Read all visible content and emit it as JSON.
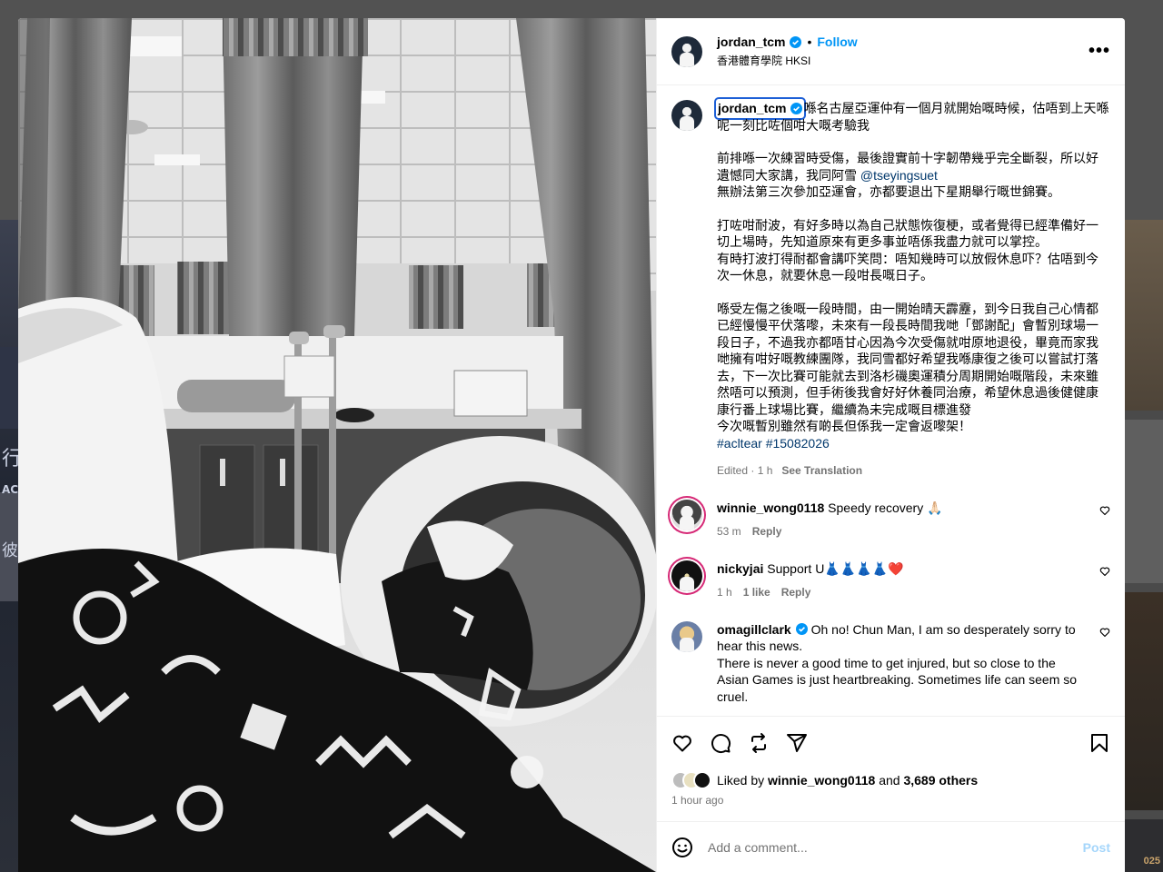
{
  "post": {
    "username": "jordan_tcm",
    "follow_label": "Follow",
    "dot": "•",
    "location": "香港體育學院 HKSI",
    "more_label": "•••",
    "caption": {
      "username": "jordan_tcm",
      "first_line": "喺名古屋亞運仲有一個月就開始嘅時候，估唔到上天喺呢一刻比咗個咁大嘅考驗我",
      "para2_a": "前排喺一次練習時受傷，最後證實前十字韌帶幾乎完全斷裂，所以好遺憾同大家講，我同阿雪 ",
      "mention": "@tseyingsuet",
      "para2_b": "\n無辦法第三次參加亞運會，亦都要退出下星期舉行嘅世錦賽。",
      "para3": "打咗咁耐波，有好多時以為自己狀態恢復梗，或者覺得已經準備好一切上場時，先知道原來有更多事並唔係我盡力就可以掌控。\n有時打波打得耐都會講吓笑問：唔知幾時可以放假休息吓？估唔到今次一休息，就要休息一段咁長嘅日子。",
      "para4": "喺受左傷之後嘅一段時間，由一開始晴天霹靂，到今日我自己心情都已經慢慢平伏落嚟，未來有一段長時間我哋「鄧謝配」會暫別球場一段日子，不過我亦都唔甘心因為今次受傷就咁原地退役，畢竟而家我哋擁有咁好嘅教練團隊，我同雪都好希望我喺康復之後可以嘗試打落去，下一次比賽可能就去到洛杉磯奧運積分周期開始嘅階段，未來雖然唔可以預測，但手術後我會好好休養同治療，希望休息過後健健康康行番上球場比賽，繼續為未完成嘅目標進發\n今次嘅暫別雖然有啲長但係我一定會返嚟架！",
      "hashtags": "#acltear #15082026",
      "edited": "Edited · 1 h",
      "see_translation": "See Translation"
    },
    "comments": [
      {
        "username": "winnie_wong0118",
        "text": "Speedy recovery 🙏🏻",
        "time": "53 m",
        "likes": "",
        "reply": "Reply",
        "avatar_color": "#c9c9c9"
      },
      {
        "username": "nickyjai",
        "text": "Support U👗👗👗👗❤️",
        "time": "1 h",
        "likes": "1 like",
        "reply": "Reply",
        "avatar_color": "#1a1a1a"
      },
      {
        "username": "omagillclark",
        "text": "Oh no! Chun Man, I am so desperately sorry to hear this news.\nThere is never a good time to get injured, but so close to the Asian Games is just heartbreaking. Sometimes life can seem so cruel.",
        "time": "",
        "likes": "",
        "reply": "",
        "avatar_color": "#b69a6a"
      }
    ],
    "liked_by_prefix": "Liked by ",
    "liked_by_user": "winnie_wong0118",
    "liked_by_and": " and ",
    "liked_by_others": "3,689 others",
    "posted_time": "1 hour ago",
    "comment_placeholder": "Add a comment...",
    "post_button": "Post"
  },
  "background": {
    "left_glyphs": [
      "行",
      "AC",
      "彼"
    ],
    "right_label": "025"
  },
  "colors": {
    "accent_blue": "#0095f6",
    "verified_blue": "#0095f6",
    "link_blue": "#00376b",
    "muted": "#737373",
    "post_disabled": "#a5d6fb"
  },
  "icons": [
    "verified-badge-icon",
    "more-options-icon",
    "heart-icon",
    "comment-icon",
    "repost-icon",
    "share-icon",
    "bookmark-icon",
    "emoji-icon"
  ]
}
